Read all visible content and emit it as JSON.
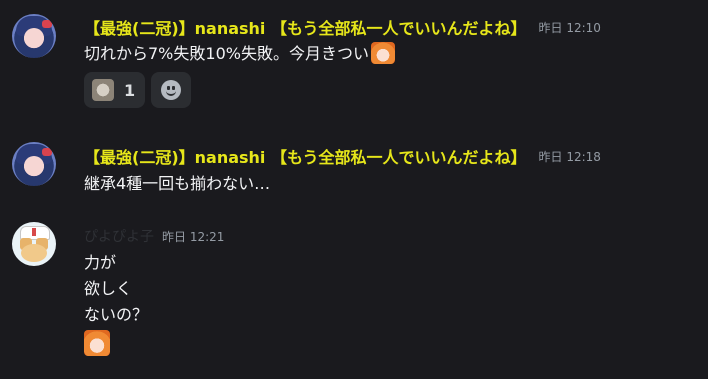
{
  "messages": [
    {
      "author": "【最強(二冠)】nanashi 【もう全部私一人でいいんだよね】",
      "time": "昨日 12:10",
      "text": "切れから7%失敗10%失敗。今月きつい",
      "reaction_count": "1"
    },
    {
      "author": "【最強(二冠)】nanashi 【もう全部私一人でいいんだよね】",
      "time": "昨日 12:18",
      "text": "継承4種一回も揃わない…"
    },
    {
      "author": "ぴよぴよ子",
      "time": "昨日 12:21",
      "lines": [
        "力が",
        "欲しく",
        "ないの？"
      ]
    }
  ],
  "colors": {
    "author": "#e6e61a",
    "background": "#1a1a1e",
    "timestamp": "#949ba4"
  }
}
